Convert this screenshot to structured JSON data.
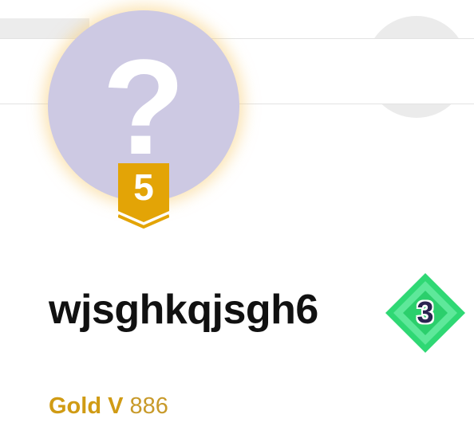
{
  "profile": {
    "username": "wjsghkqjsgh6",
    "avatar_icon": "question-mark-icon",
    "avatar_glyph": "?",
    "level": "5",
    "rank_badge_value": "3",
    "league": {
      "name": "Gold V",
      "points": "886"
    }
  },
  "colors": {
    "avatar_bg": "#cdc9e3",
    "level_badge": "#e3a406",
    "rank_diamond": "#2fd874",
    "league_text": "#d09b14",
    "username_text": "#111111"
  }
}
